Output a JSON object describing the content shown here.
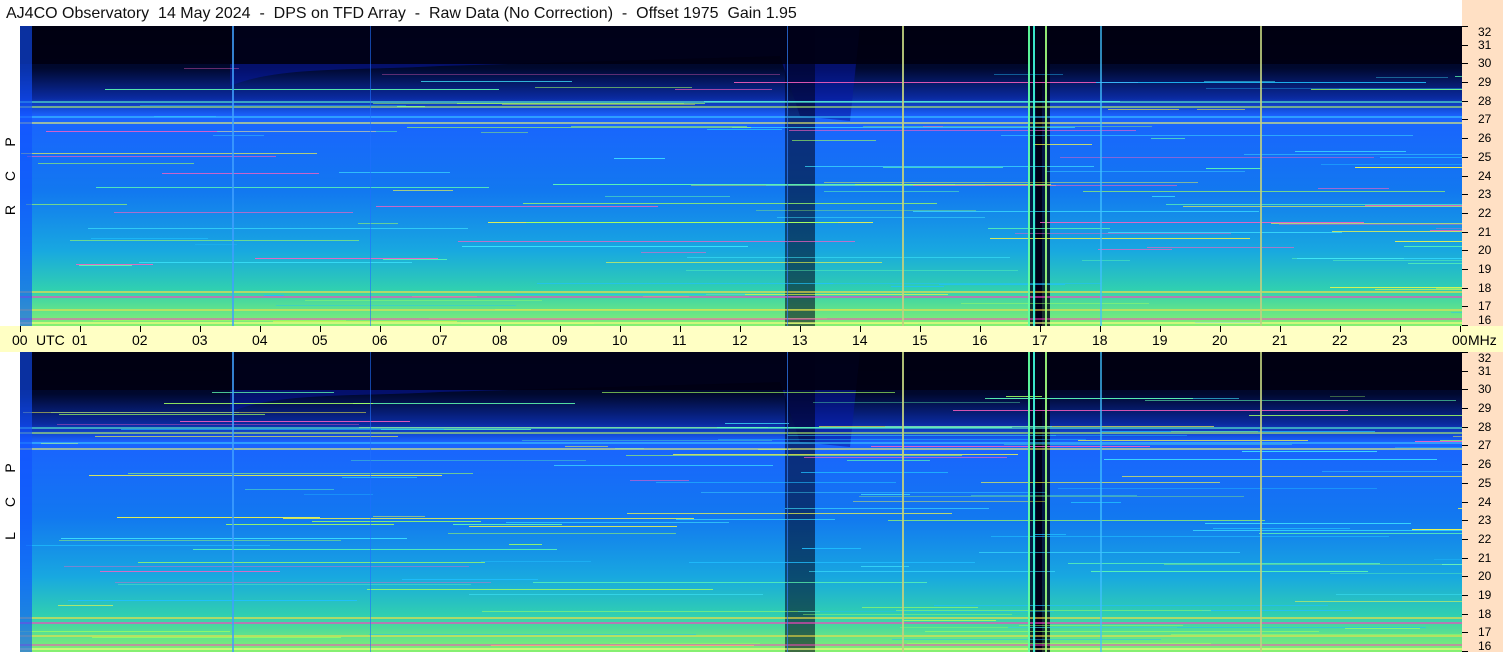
{
  "title": "AJ4CO Observatory  14 May 2024  -  DPS on TFD Array  -  Raw Data (No Correction)  -  Offset 1975  Gain 1.95",
  "panels": [
    {
      "id": "rcp",
      "label_letters": [
        "P",
        "C",
        "R"
      ]
    },
    {
      "id": "lcp",
      "label_letters": [
        "P",
        "C",
        "L"
      ]
    }
  ],
  "frequency_axis": {
    "unit": "MHz",
    "min": 16,
    "max": 32,
    "labels": [
      "32",
      "31",
      "30",
      "29",
      "28",
      "27",
      "26",
      "25",
      "24",
      "23",
      "22",
      "21",
      "20",
      "19",
      "18",
      "17",
      "16"
    ]
  },
  "time_axis": {
    "unit_label": "UTC",
    "labels": [
      "00",
      "01",
      "02",
      "03",
      "04",
      "05",
      "06",
      "07",
      "08",
      "09",
      "10",
      "11",
      "12",
      "13",
      "14",
      "15",
      "16",
      "17",
      "18",
      "19",
      "20",
      "21",
      "22",
      "23",
      "00"
    ],
    "end_unit": "MHz"
  },
  "colors": {
    "axis_background": "#ffe0c4",
    "time_axis_background": "#ffffc4",
    "spectrogram_low": "#000022",
    "spectrogram_mid": "#1060ff",
    "spectrogram_high": "#ffff40",
    "interference_line": "#ff40c0"
  }
}
